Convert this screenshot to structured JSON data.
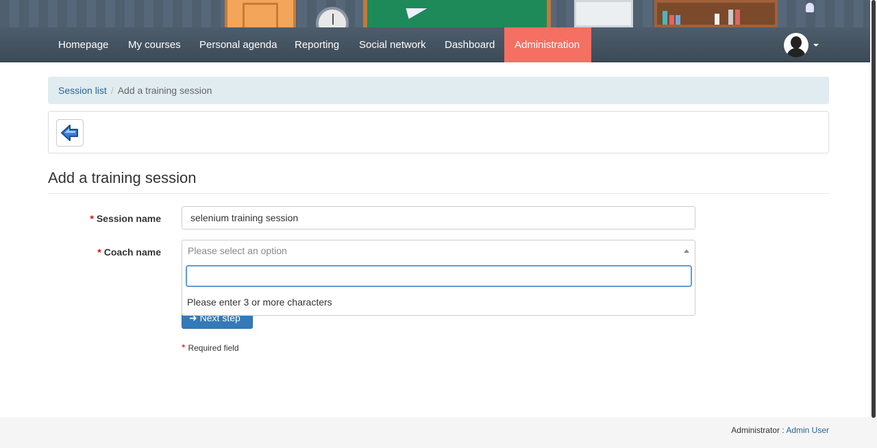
{
  "nav": {
    "items": [
      {
        "label": "Homepage"
      },
      {
        "label": "My courses"
      },
      {
        "label": "Personal agenda"
      },
      {
        "label": "Reporting"
      },
      {
        "label": "Social network"
      },
      {
        "label": "Dashboard"
      },
      {
        "label": "Administration",
        "active": true
      }
    ],
    "active_color": "#f56f62"
  },
  "breadcrumb": {
    "parent": "Session list",
    "separator": "/",
    "current": "Add a training session"
  },
  "toolbar": {
    "back_icon": "back-arrow-icon"
  },
  "page_title": "Add a training session",
  "form": {
    "session_name": {
      "label": "Session name",
      "value": "selenium training session"
    },
    "coach_name": {
      "label": "Coach name",
      "placeholder": "Please select an option"
    },
    "dropdown": {
      "search_value": "",
      "message": "Please enter 3 or more characters"
    },
    "next_button": "Next step",
    "required_note": "Required field",
    "required_mark": "*"
  },
  "footer": {
    "role_label": "Administrator :",
    "user_link": "Admin User"
  }
}
